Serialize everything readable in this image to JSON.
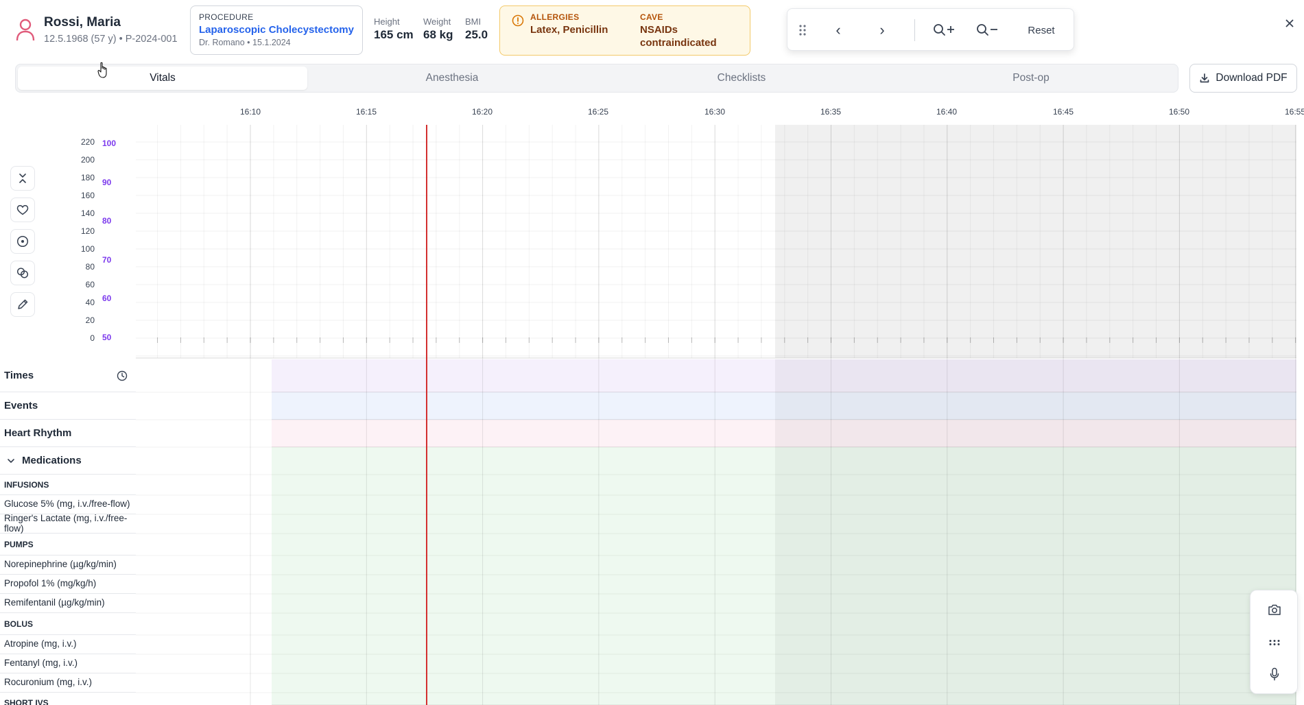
{
  "patient": {
    "name": "Rossi, Maria",
    "meta": "12.5.1968 (57 y) • P-2024-001"
  },
  "procedure": {
    "label": "PROCEDURE",
    "name": "Laparoscopic Cholecystectomy",
    "surgeon_date": "Dr. Romano • 15.1.2024"
  },
  "measurements": {
    "height_label": "Height",
    "height_value": "165 cm",
    "weight_label": "Weight",
    "weight_value": "68 kg",
    "bmi_label": "BMI",
    "bmi_value": "25.0"
  },
  "alerts": {
    "allergies_label": "ALLERGIES",
    "allergies_value": "Latex, Penicillin",
    "cave_label": "CAVE",
    "cave_value": "NSAIDs contraindicated",
    "color": "#fef8e6"
  },
  "toolbar": {
    "prev": "‹",
    "next": "›",
    "reset": "Reset"
  },
  "tabs": [
    "Vitals",
    "Anesthesia",
    "Checklists",
    "Post-op"
  ],
  "active_tab": "Vitals",
  "download_label": "Download PDF",
  "timeline": {
    "labels": [
      "16:10",
      "16:15",
      "16:20",
      "16:25",
      "16:30",
      "16:35",
      "16:40",
      "16:45",
      "16:50",
      "16:55"
    ],
    "now_line_color": "#d32f2f"
  },
  "vitals_axis": {
    "left": [
      "220",
      "200",
      "180",
      "160",
      "140",
      "120",
      "100",
      "80",
      "60",
      "40",
      "20",
      "0"
    ],
    "right": [
      "100",
      "90",
      "80",
      "70",
      "60",
      "50"
    ],
    "right_color": "#7c3aed"
  },
  "side_icons": [
    "collapse-icon",
    "heart-icon",
    "target-icon",
    "link-icon",
    "pencil-icon"
  ],
  "rows": {
    "times": "Times",
    "events": "Events",
    "heart_rhythm": "Heart Rhythm",
    "medications": "Medications",
    "infusions": "INFUSIONS",
    "glucose": "Glucose 5% (mg, i.v./free-flow)",
    "ringer": "Ringer's Lactate (mg, i.v./free-flow)",
    "pumps": "PUMPS",
    "norepinephrine": "Norepinephrine (µg/kg/min)",
    "propofol": "Propofol 1% (mg/kg/h)",
    "remifentanil": "Remifentanil (µg/kg/min)",
    "bolus": "BOLUS",
    "atropine": "Atropine (mg, i.v.)",
    "fentanyl": "Fentanyl (mg, i.v.)",
    "rocuronium": "Rocuronium (mg, i.v.)",
    "short_ivs": "SHORT IVS"
  },
  "colors": {
    "times_band": "#f5f0fc",
    "events_band": "#eef3fd",
    "rhythm_band": "#fdf2f6",
    "meds_band": "#eef9f0"
  },
  "float_panel": [
    "camera-icon",
    "grid-dots-icon",
    "microphone-icon"
  ]
}
